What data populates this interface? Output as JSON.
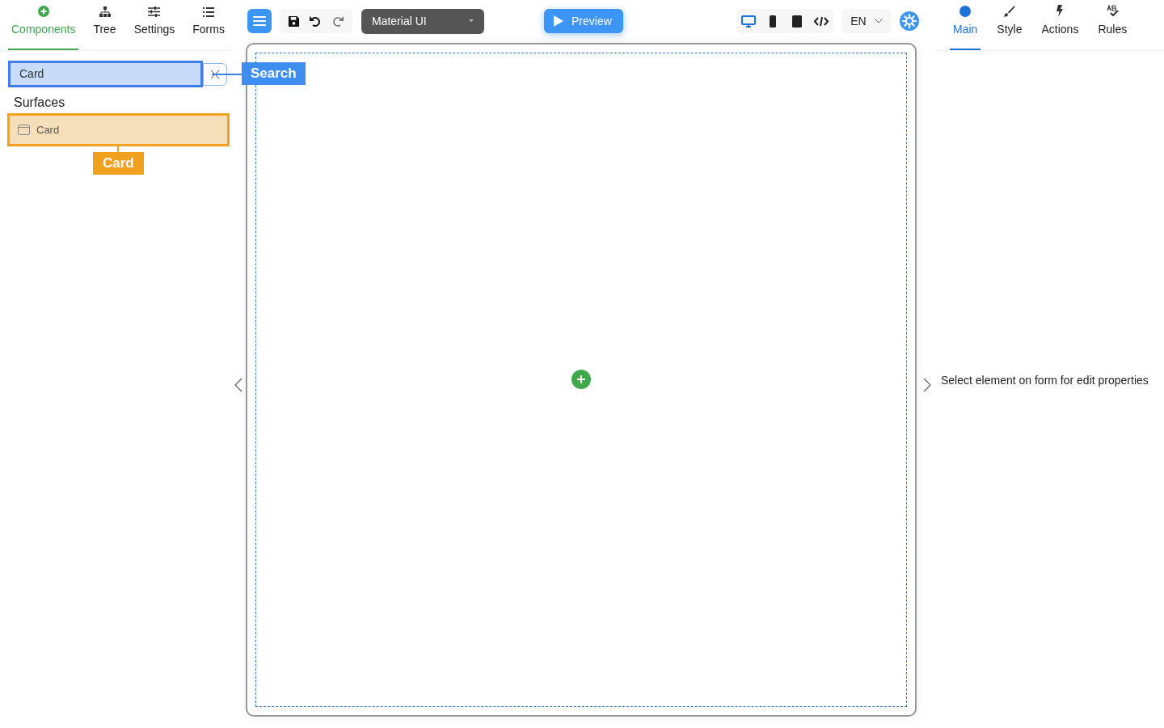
{
  "left_tabs": [
    {
      "kind": "add",
      "label": "Components",
      "selected": true
    },
    {
      "kind": "tree",
      "label": "Tree",
      "selected": false
    },
    {
      "kind": "sliders",
      "label": "Settings",
      "selected": false
    },
    {
      "kind": "list",
      "label": "Forms",
      "selected": false
    }
  ],
  "search": {
    "value": "Card",
    "callout": "Search"
  },
  "groups": [
    {
      "title": "Surfaces",
      "items": [
        {
          "label": "Card",
          "callout": "Card"
        }
      ]
    }
  ],
  "toolbar": {
    "framework": "Material UI",
    "preview": "Preview",
    "devices": [
      {
        "kind": "desktop",
        "selected": true
      },
      {
        "kind": "phone",
        "selected": false
      },
      {
        "kind": "tablet",
        "selected": false
      },
      {
        "kind": "code",
        "selected": false
      }
    ],
    "language": "EN"
  },
  "right_tabs": [
    {
      "kind": "dot",
      "label": "Main",
      "selected": true
    },
    {
      "kind": "brush",
      "label": "Style",
      "selected": false
    },
    {
      "kind": "bolt",
      "label": "Actions",
      "selected": false
    },
    {
      "kind": "rules",
      "label": "Rules",
      "selected": false
    }
  ],
  "properties_hint": "Select element on form for edit properties"
}
